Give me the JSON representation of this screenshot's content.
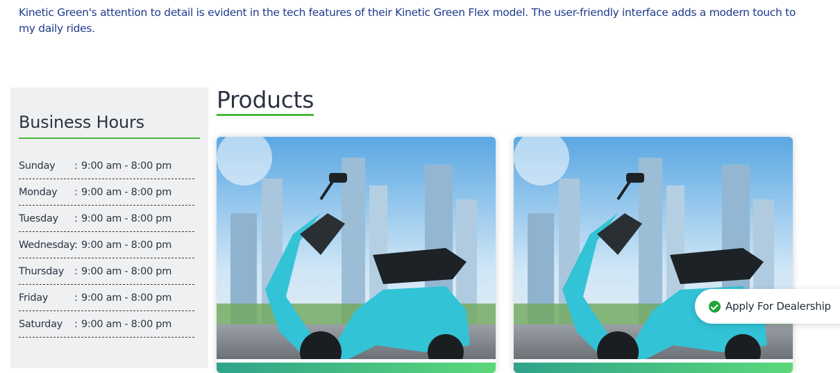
{
  "review": {
    "text": "Kinetic Green's attention to detail is evident in the tech features of their Kinetic Green Flex model. The user-friendly interface adds a modern touch to my daily rides."
  },
  "business_hours": {
    "title": "Business Hours",
    "days": [
      {
        "day": "Sunday",
        "sep": ":",
        "time": "9:00 am - 8:00 pm"
      },
      {
        "day": "Monday",
        "sep": ":",
        "time": "9:00 am - 8:00 pm"
      },
      {
        "day": "Tuesday",
        "sep": ":",
        "time": "9:00 am - 8:00 pm"
      },
      {
        "day": "Wednesday",
        "sep": ":",
        "time": "9:00 am - 8:00 pm"
      },
      {
        "day": "Thursday",
        "sep": ":",
        "time": "9:00 am - 8:00 pm"
      },
      {
        "day": "Friday",
        "sep": ":",
        "time": "9:00 am - 8:00 pm"
      },
      {
        "day": "Saturday",
        "sep": ":",
        "time": "9:00 am - 8:00 pm"
      }
    ]
  },
  "products": {
    "title": "Products",
    "items": [
      {
        "image": "teal-electric-scooter-city-photo"
      },
      {
        "image": "teal-electric-scooter-city-photo"
      }
    ]
  },
  "dealer_button": {
    "label": "Apply For Dealership",
    "icon": "check-circle-icon"
  },
  "colors": {
    "accent_green": "#49b73b",
    "scooter_teal": "#33c3d6",
    "text_dark": "#2b3342",
    "panel_bg": "#eff0f2"
  }
}
